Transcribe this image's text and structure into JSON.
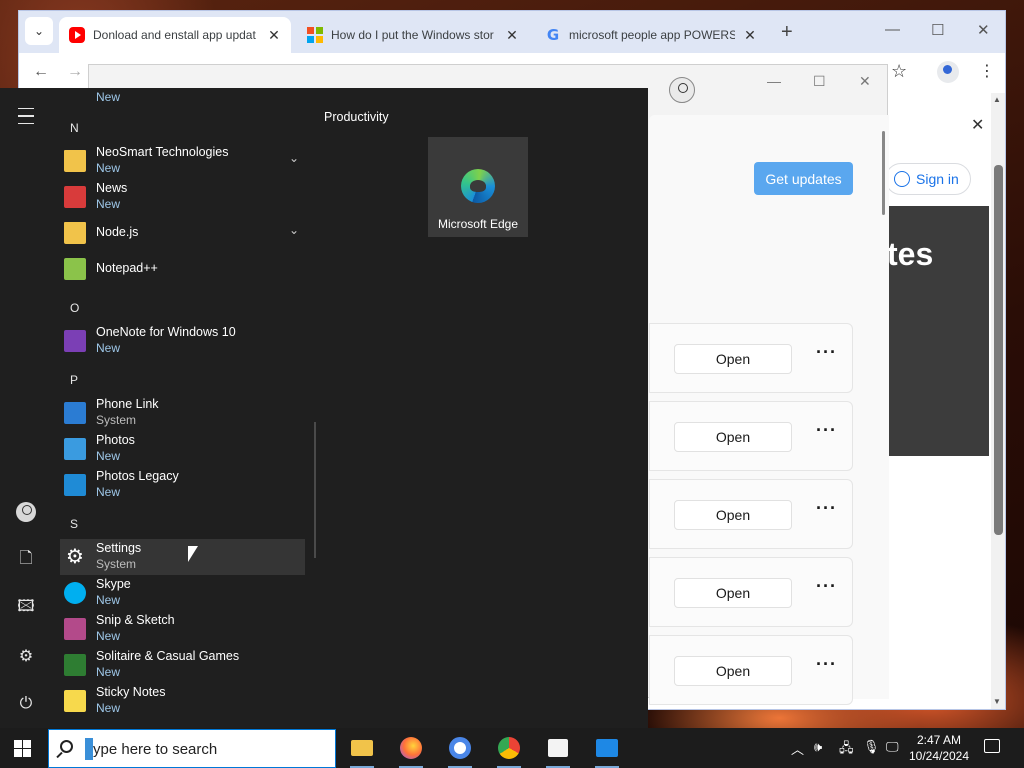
{
  "browser": {
    "tabs": [
      {
        "title": "Donload and enstall app updat",
        "favicon": "youtube-icon",
        "active": true
      },
      {
        "title": "How do I put the Windows stor",
        "favicon": "microsoft-icon",
        "active": false
      },
      {
        "title": "microsoft people app POWERS",
        "favicon": "google-icon",
        "active": false
      }
    ],
    "new_tab": "+",
    "page": {
      "sign_in": "Sign in",
      "hero_text": "tes"
    }
  },
  "store": {
    "get_updates": "Get updates",
    "apps": [
      {
        "open": "Open",
        "more": "···"
      },
      {
        "open": "Open",
        "more": "···"
      },
      {
        "open": "Open",
        "more": "···"
      },
      {
        "open": "Open",
        "more": "···"
      },
      {
        "open": "Open",
        "more": "···"
      }
    ]
  },
  "start_menu": {
    "partial_top_sub": "New",
    "letters": {
      "n": "N",
      "o": "O",
      "p": "P",
      "s": "S"
    },
    "apps": [
      {
        "name": "NeoSmart Technologies",
        "sub": "New"
      },
      {
        "name": "News",
        "sub": "New"
      },
      {
        "name": "Node.js",
        "sub": ""
      },
      {
        "name": "Notepad++",
        "sub": ""
      },
      {
        "name": "OneNote for Windows 10",
        "sub": "New"
      },
      {
        "name": "Phone Link",
        "sub": "System"
      },
      {
        "name": "Photos",
        "sub": "New"
      },
      {
        "name": "Photos Legacy",
        "sub": "New"
      },
      {
        "name": "Settings",
        "sub": "System"
      },
      {
        "name": "Skype",
        "sub": "New"
      },
      {
        "name": "Snip & Sketch",
        "sub": "New"
      },
      {
        "name": "Solitaire & Casual Games",
        "sub": "New"
      },
      {
        "name": "Sticky Notes",
        "sub": "New"
      }
    ],
    "tiles_group": "Productivity",
    "tile": {
      "label": "Microsoft Edge"
    }
  },
  "taskbar": {
    "search_placeholder": "ype here to search",
    "time": "2:47 AM",
    "date": "10/24/2024"
  }
}
